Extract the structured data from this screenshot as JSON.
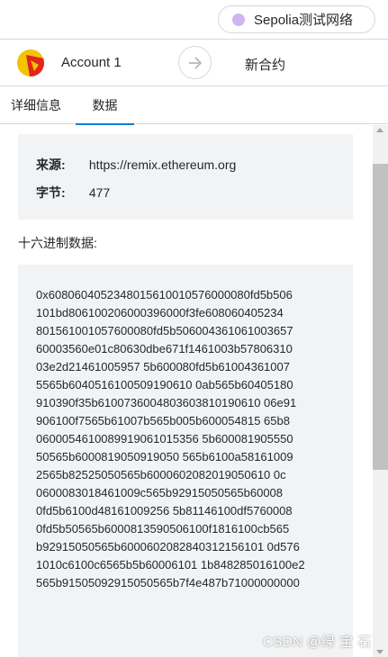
{
  "network": {
    "label": "Sepolia测试网络",
    "dot_color": "#cfb5f0"
  },
  "account": {
    "name": "Account 1",
    "avatar_icon": "account-jazzicon"
  },
  "transfer": {
    "arrow_icon": "arrow-right-icon",
    "target": "新合约"
  },
  "tabs": [
    {
      "label": "详细信息",
      "active": false
    },
    {
      "label": "数据",
      "active": true
    }
  ],
  "info": {
    "origin_label": "来源:",
    "origin_value": "https://remix.ethereum.org",
    "bytes_label": "字节:",
    "bytes_value": "477"
  },
  "hex": {
    "label": "十六进制数据:",
    "lines": [
      "0x6080604052348015610010576000080fd5b506",
      "101bd806100206000396000f3fe608060405234",
      "80156100105760008​0fd5b506004361061003657",
      "60003560e01c80630dbe671f1461003b57806310",
      "03e2d21461005957 5b600080fd5b61004361007",
      "5565b6040516100509190610 0ab565b60405180",
      "910390f35b6100736004803603810190610 06e91",
      "906100f7565b61007b565b005b600054815 65b8",
      "0600054610089919061015356 5b600081905550",
      "50565b6000819050919050 565b6100a58161009",
      "2565b82525050565b6000602082019050610 0c",
      "0600083018461009c565b92915050565b60008",
      "0fd5b6100d48161009256 5b81146100df5760008",
      "0fd5b50565b6000813590506100f1816100cb565",
      "b92915050565b6000602082840312156101 0d576",
      "1010c6100c6565b5b60006101 1b848285016100e2",
      "565b91505092915050565b7f4e487b71000000000"
    ]
  },
  "watermark": "CSDN @绿 宝 石",
  "colors": {
    "accent": "#037dd6",
    "panel": "#f2f3f4",
    "border": "#d6d9dc"
  }
}
